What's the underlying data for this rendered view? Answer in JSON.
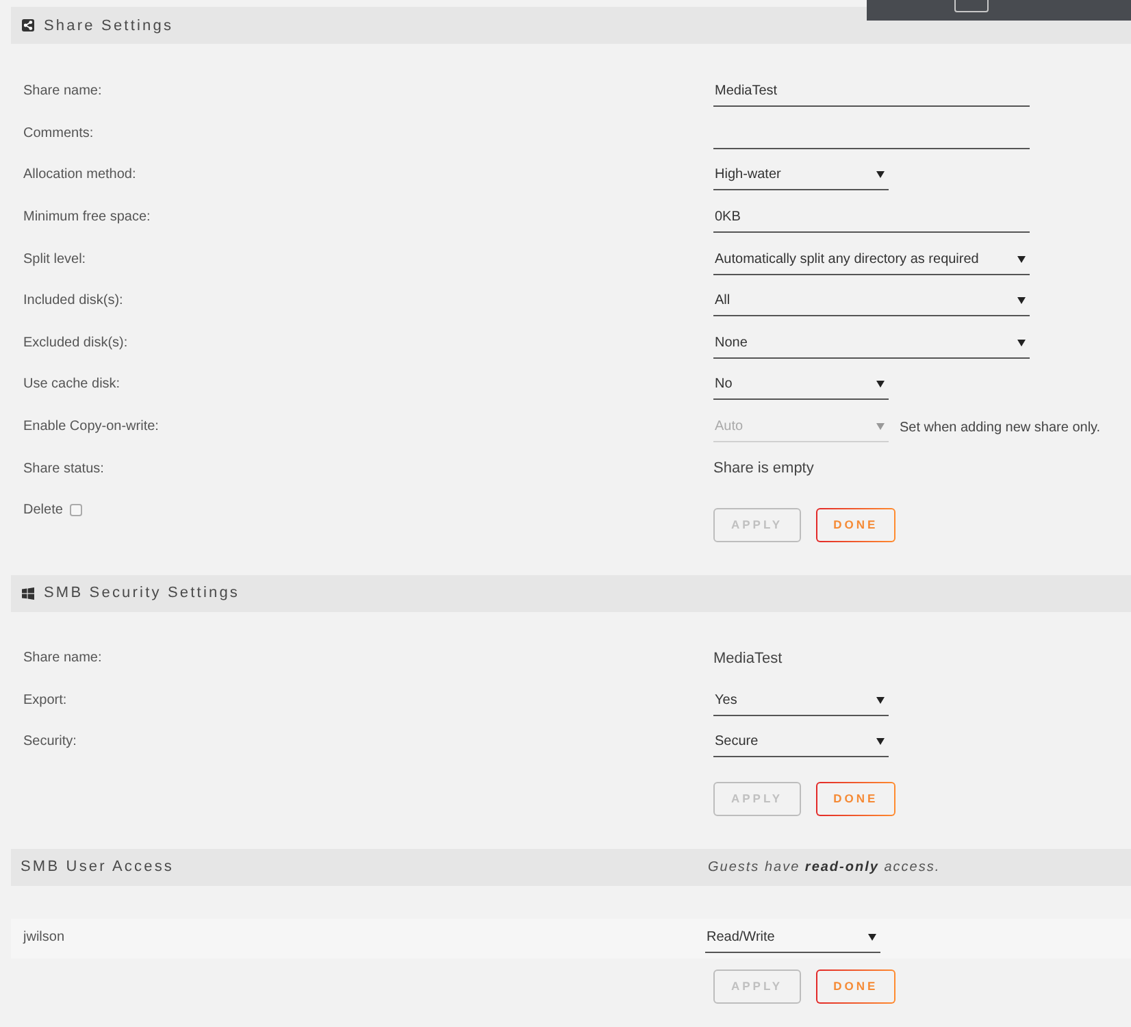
{
  "share_settings": {
    "title": "Share Settings",
    "fields": [
      {
        "label": "Share name:",
        "kind": "input",
        "value": "MediaTest",
        "disabled": false
      },
      {
        "label": "Comments:",
        "kind": "input",
        "disabled": false
      },
      {
        "label": "Allocation method:",
        "kind": "select",
        "value": "High-water",
        "disabled": false
      },
      {
        "label": "Minimum free space:",
        "kind": "input",
        "value": "0KB",
        "disabled": false
      },
      {
        "label": "Split level:",
        "kind": "select",
        "value": "Automatically split any directory as required",
        "disabled": false
      },
      {
        "label": "Included disk(s):",
        "kind": "select",
        "value": "All",
        "disabled": false
      },
      {
        "label": "Excluded disk(s):",
        "kind": "select",
        "value": "None",
        "disabled": false
      },
      {
        "label": "Use cache disk:",
        "kind": "select",
        "value": "No",
        "disabled": false
      },
      {
        "label": "Enable Copy-on-write:",
        "kind": "select",
        "value": "Auto",
        "disabled": true,
        "note": "Set when adding new share only."
      },
      {
        "label": "Share status:",
        "kind": "text",
        "value": "Share is empty"
      }
    ],
    "delete": {
      "label": "Delete",
      "checked": false
    },
    "buttons": [
      {
        "label": "APPLY",
        "disabled": true
      },
      {
        "label": "DONE",
        "disabled": false
      }
    ]
  },
  "smb_security": {
    "title": "SMB Security Settings",
    "fields": [
      {
        "label": "Share name:",
        "kind": "text",
        "value": "MediaTest"
      },
      {
        "label": "Export:",
        "kind": "select",
        "value": "Yes",
        "disabled": false
      },
      {
        "label": "Security:",
        "kind": "select",
        "value": "Secure",
        "disabled": false
      }
    ],
    "buttons": [
      {
        "label": "APPLY",
        "disabled": true
      },
      {
        "label": "DONE",
        "disabled": false
      }
    ]
  },
  "smb_user_access": {
    "title": "SMB User Access",
    "note": "Guests have **read-only** access.",
    "users": [
      {
        "name": "jwilson",
        "access": "Read/Write"
      }
    ],
    "buttons": [
      {
        "label": "APPLY",
        "disabled": true
      },
      {
        "label": "DONE",
        "disabled": false
      }
    ]
  }
}
